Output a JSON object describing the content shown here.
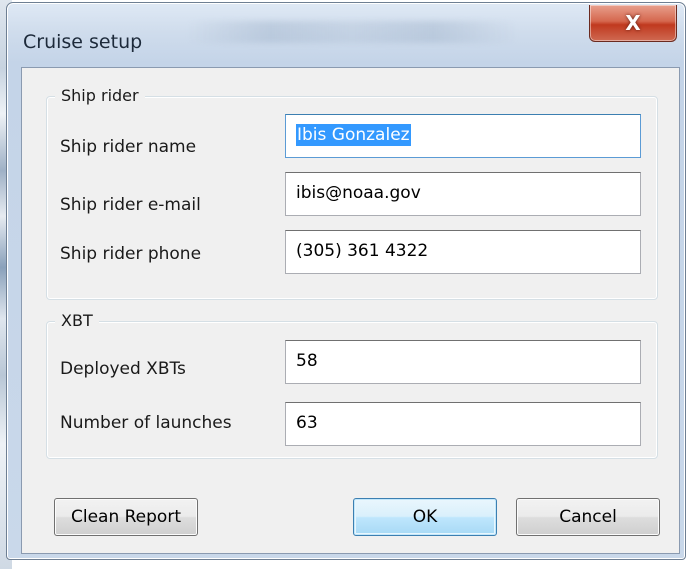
{
  "window": {
    "title": "Cruise setup",
    "close_symbol": "X"
  },
  "ship_rider": {
    "group_label": "Ship rider",
    "name_label": "Ship rider name",
    "name_value": "Ibis Gonzalez",
    "email_label": "Ship rider e-mail",
    "email_value": "ibis@noaa.gov",
    "phone_label": "Ship rider phone",
    "phone_value": "(305) 361 4322"
  },
  "xbt": {
    "group_label": "XBT",
    "deployed_label": "Deployed XBTs",
    "deployed_value": "58",
    "launches_label": "Number of launches",
    "launches_value": "63"
  },
  "buttons": {
    "clean_report": "Clean Report",
    "ok": "OK",
    "cancel": "Cancel"
  },
  "colors": {
    "selection": "#3399ff",
    "close_button": "#c0391f",
    "default_button_border": "#3c7fb1"
  },
  "icons": {
    "close": "close-icon"
  }
}
